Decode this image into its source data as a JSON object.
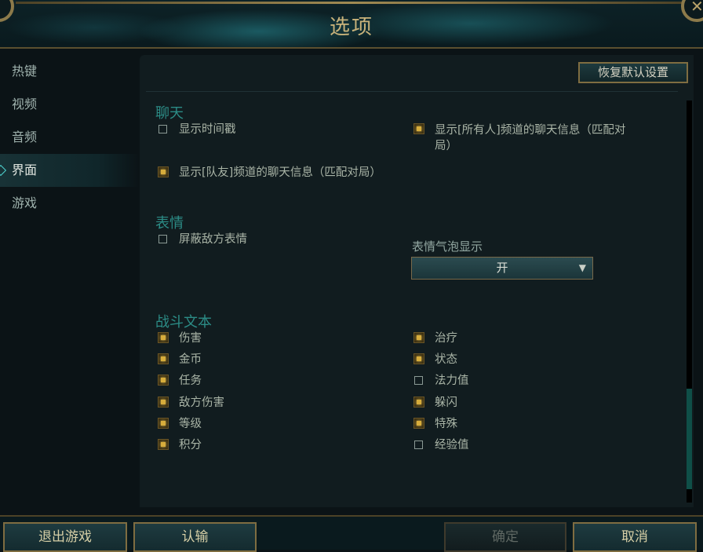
{
  "window": {
    "title": "选项",
    "close_glyph": "✕"
  },
  "sidebar": {
    "items": [
      {
        "label": "热键"
      },
      {
        "label": "视频"
      },
      {
        "label": "音频"
      },
      {
        "label": "界面",
        "active": true
      },
      {
        "label": "游戏"
      }
    ]
  },
  "toolbar": {
    "reset_label": "恢复默认设置"
  },
  "sections": {
    "chat": {
      "title": "聊天",
      "options": [
        {
          "label": "显示时间戳",
          "checked": false
        },
        {
          "label": "显示[所有人]频道的聊天信息（匹配对局）",
          "checked": true
        },
        {
          "label": "显示[队友]频道的聊天信息（匹配对局）",
          "checked": true
        }
      ]
    },
    "emotes": {
      "title": "表情",
      "options": [
        {
          "label": "屏蔽敌方表情",
          "checked": false
        }
      ],
      "bubble": {
        "label": "表情气泡显示",
        "value": "开"
      }
    },
    "combat": {
      "title": "战斗文本",
      "left": [
        {
          "label": "伤害",
          "checked": true
        },
        {
          "label": "金币",
          "checked": true
        },
        {
          "label": "任务",
          "checked": true
        },
        {
          "label": "敌方伤害",
          "checked": true
        },
        {
          "label": "等级",
          "checked": true
        },
        {
          "label": "积分",
          "checked": true
        }
      ],
      "right": [
        {
          "label": "治疗",
          "checked": true
        },
        {
          "label": "状态",
          "checked": true
        },
        {
          "label": "法力值",
          "checked": false
        },
        {
          "label": "躲闪",
          "checked": true
        },
        {
          "label": "特殊",
          "checked": true
        },
        {
          "label": "经验值",
          "checked": false
        }
      ]
    }
  },
  "footer": {
    "exit_label": "退出游戏",
    "surrender_label": "认输",
    "confirm_label": "确定",
    "cancel_label": "取消"
  },
  "colors": {
    "accent_gold": "#c8b27a",
    "section_teal": "#2c8c86",
    "checkbox_on": "#d7ad3c"
  }
}
